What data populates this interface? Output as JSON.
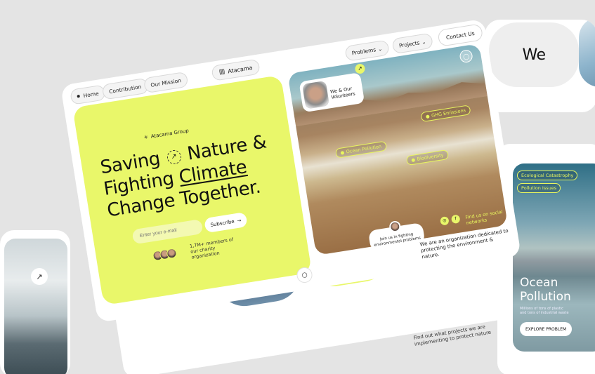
{
  "side_we": {
    "text": "We"
  },
  "ocean_card": {
    "chips": [
      "Ecological Catastrophy",
      "Pollution Issues"
    ],
    "title": "Ocean Pollution",
    "desc": "Millions of tons of plastic and tons of industrial waste",
    "button": "EXPLORE PROBLEM"
  },
  "nav": {
    "home": "Home",
    "contribution": "Contribution",
    "mission": "Our Mission",
    "brand": "Atacama",
    "problems": "Problems",
    "projects": "Projects",
    "contact": "Contact Us"
  },
  "hero": {
    "group": "Atacama Group",
    "line1a": "Saving",
    "line1b": "Nature &",
    "line2a": "Fighting",
    "line2b": "Climate",
    "line3": "Change Together.",
    "email_placeholder": "Enter your e-mail",
    "subscribe": "Subscribe",
    "members": "1,7M+ members of our charity organization"
  },
  "photo": {
    "volunteers": "We & Our Volunteers",
    "tags": [
      "GHG Emissions",
      "Ocean Pollution",
      "Biodiversity"
    ],
    "social": "Find us on social networks",
    "join": "Join us in fighting environmental problems",
    "org": "We are an organization dedicated to protecting the environment & nature."
  },
  "bottom": {
    "findout": "Find out what projects we are implementing to protect nature"
  },
  "colors": {
    "accent": "#e9f76a",
    "bg": "#e4e4e4"
  }
}
